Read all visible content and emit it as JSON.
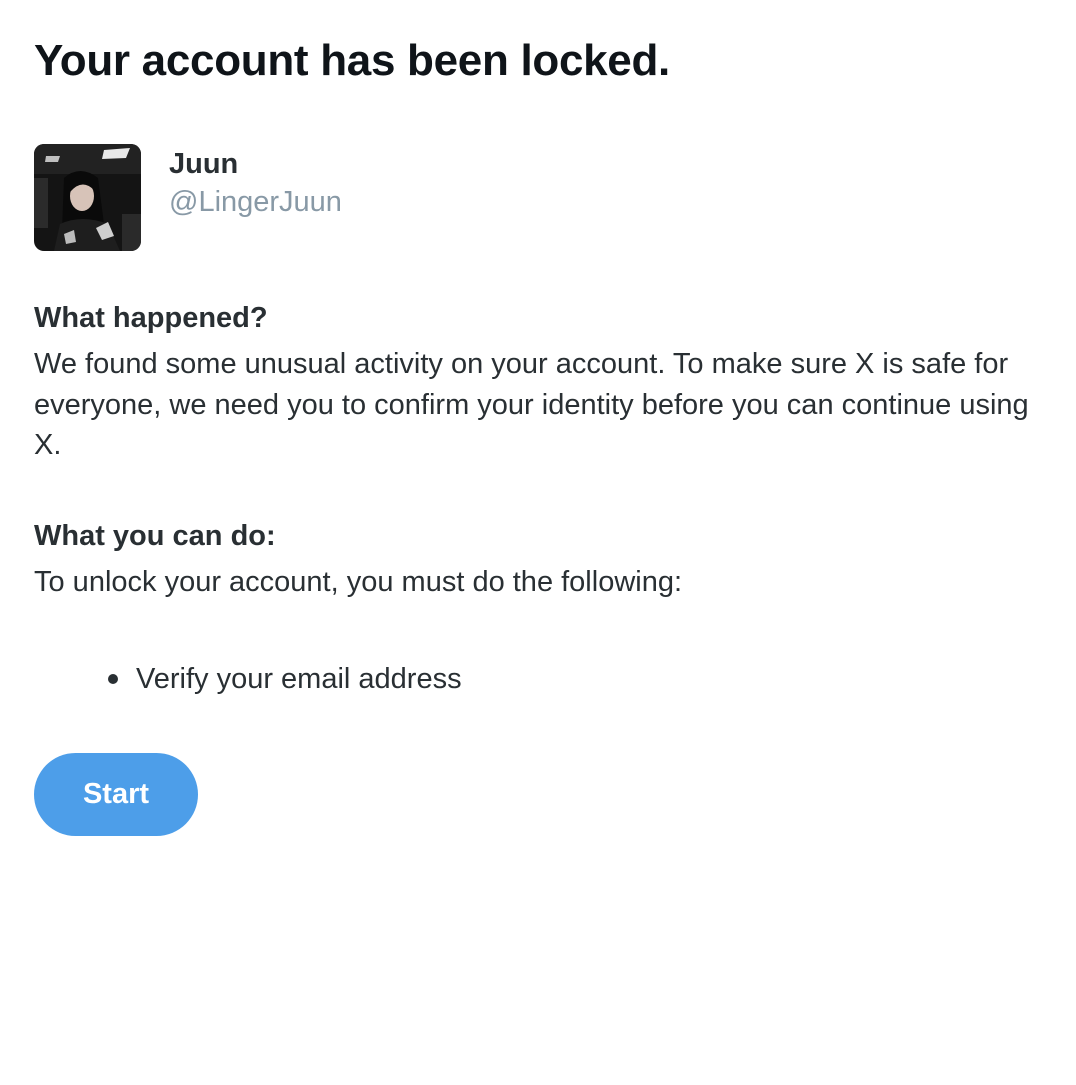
{
  "page": {
    "title": "Your account has been locked."
  },
  "profile": {
    "display_name": "Juun",
    "handle": "@LingerJuun",
    "avatar_icon": "user-avatar-photo"
  },
  "what_happened": {
    "heading": "What happened?",
    "body": "We found some unusual activity on your account. To make sure X is safe for everyone, we need you to confirm your identity before you can continue using X."
  },
  "what_you_can_do": {
    "heading": "What you can do:",
    "body": "To unlock your account, you must do the following:",
    "steps": [
      {
        "label": "Verify your email address"
      }
    ]
  },
  "actions": {
    "start_label": "Start"
  },
  "colors": {
    "primary_button": "#4d9ee9",
    "handle_text": "#8899a6",
    "body_text": "#292f33"
  }
}
